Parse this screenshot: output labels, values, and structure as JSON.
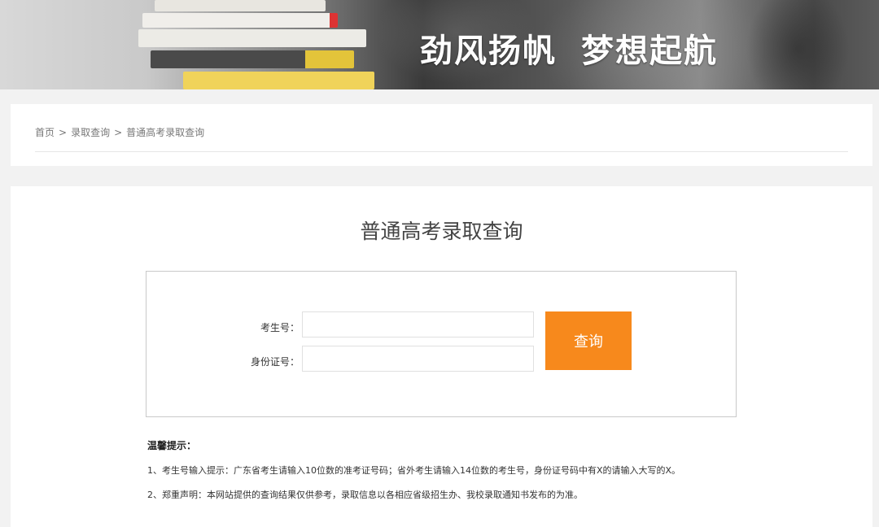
{
  "banner": {
    "slogan_part1": "劲风扬帆",
    "slogan_part2": "梦想起航"
  },
  "breadcrumb": {
    "items": [
      "首页",
      "录取查询",
      "普通高考录取查询"
    ],
    "separator": ">"
  },
  "page": {
    "title": "普通高考录取查询"
  },
  "form": {
    "exam_no_label": "考生号：",
    "exam_no_value": "",
    "id_no_label": "身份证号：",
    "id_no_value": "",
    "submit_label": "查询"
  },
  "tips": {
    "title": "温馨提示：",
    "items": [
      "1、考生号输入提示：广东省考生请输入10位数的准考证号码；省外考生请输入14位数的考生号，身份证号码中有X的请输入大写的X。",
      "2、郑重声明：本网站提供的查询结果仅供参考，录取信息以各相应省级招生办、我校录取通知书发布的为准。"
    ]
  },
  "colors": {
    "accent": "#f7891c",
    "page_bg": "#f2f2f2"
  }
}
